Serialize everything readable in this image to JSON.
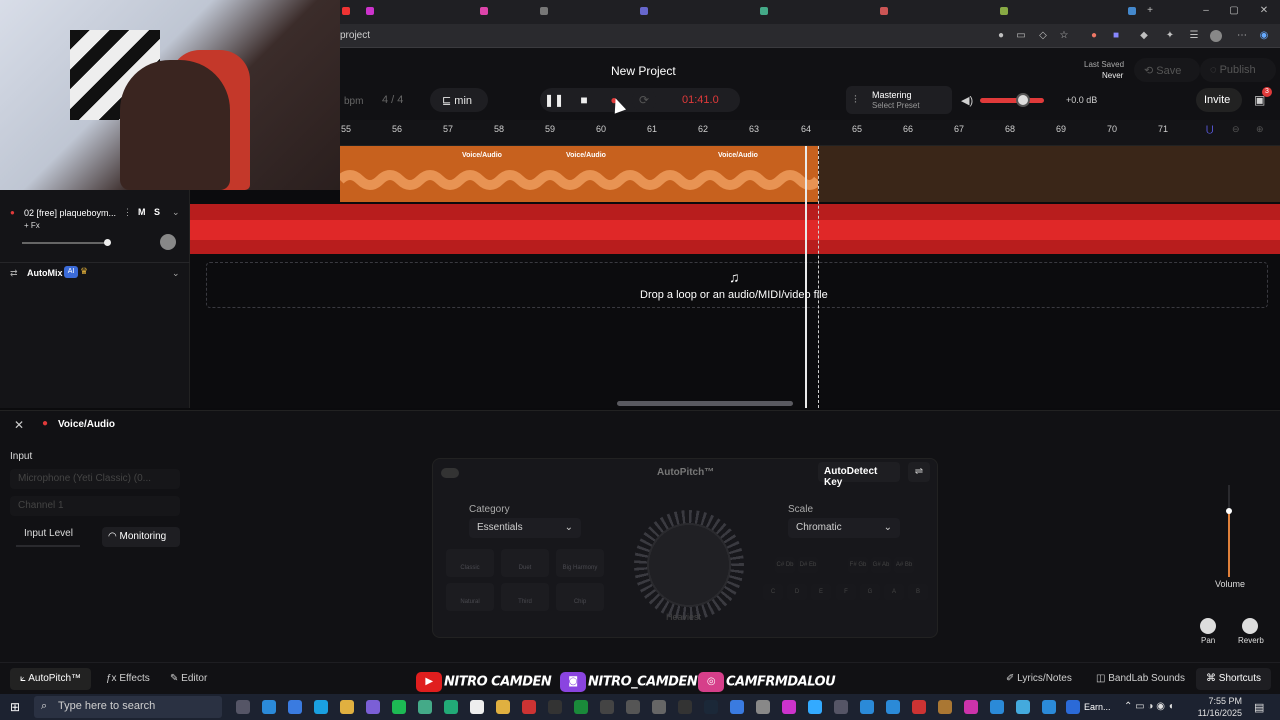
{
  "browser": {
    "url": "project",
    "tray_icons": [
      "mic-icon",
      "window-icon",
      "extension-icon",
      "star-icon",
      "profile-icon"
    ]
  },
  "topbar": {
    "project_title": "New Project",
    "last_saved_label": "Last Saved",
    "last_saved_value": "Never",
    "save_label": "Save",
    "publish_label": "Publish",
    "bpm_label": "bpm",
    "time_signature": "4 / 4",
    "key_label": "min",
    "time_display": "01:41.0",
    "mastering_title": "Mastering",
    "mastering_subtitle": "Select Preset",
    "volume_db": "+0.0 dB",
    "invite_label": "Invite",
    "notification_count": "3"
  },
  "ruler": {
    "bars": [
      "55",
      "56",
      "57",
      "58",
      "59",
      "60",
      "61",
      "62",
      "63",
      "64",
      "65",
      "66",
      "67",
      "68",
      "69",
      "70",
      "71"
    ]
  },
  "tracks": {
    "track1": {
      "clips": [
        "Voice/Audio",
        "Voice/Audio",
        "Voice/Audio"
      ]
    },
    "track2": {
      "name": "02 [free] plaqueboym...",
      "mute": "M",
      "solo": "S",
      "fx": "+ Fx"
    },
    "automix": {
      "label": "AutoMix",
      "badge": "AI"
    },
    "dropzone_text": "Drop a loop or an audio/MIDI/video file"
  },
  "editor": {
    "title": "Voice/Audio",
    "input_label": "Input",
    "input_device": "Microphone (Yeti Classic) (0...",
    "channel": "Channel 1",
    "input_level_label": "Input Level",
    "monitoring_label": "Monitoring",
    "autopitch": {
      "title": "AutoPitch™",
      "autodetect_label": "AutoDetect Key",
      "category_label": "Category",
      "category_value": "Essentials",
      "scale_label": "Scale",
      "scale_value": "Chromatic",
      "knob_label": "Heaviest",
      "presets": [
        "Classic",
        "Duet",
        "Big Harmony",
        "Natural",
        "Third",
        "Chip"
      ],
      "key_row1": [
        "C#\nDb",
        "D#\nEb",
        "F#\nGb",
        "G#\nAb",
        "A#\nBb"
      ],
      "key_row2": [
        "C",
        "D",
        "E",
        "F",
        "G",
        "A",
        "B"
      ]
    },
    "volume_label": "Volume",
    "pan_label": "Pan",
    "reverb_label": "Reverb"
  },
  "bottombar": {
    "autopitch_tab": "AutoPitch™",
    "effects_tab": "Effects",
    "editor_tab": "Editor",
    "lyrics_label": "Lyrics/Notes",
    "sounds_label": "BandLab Sounds",
    "shortcuts_label": "Shortcuts"
  },
  "social": {
    "youtube": "NITRO CAMDEN",
    "twitch": "NITRO_CAMDEN",
    "instagram": "CAMFRMDALOU"
  },
  "taskbar": {
    "search_placeholder": "Type here to search",
    "time": "7:55 PM",
    "date": "11/16/2025",
    "active_app": "Earn..."
  },
  "colors": {
    "track1_clip": "#c7611e",
    "track2": "#b81d1d",
    "time_display": "#e03a3a",
    "accent_volume": "#e03a3a"
  }
}
